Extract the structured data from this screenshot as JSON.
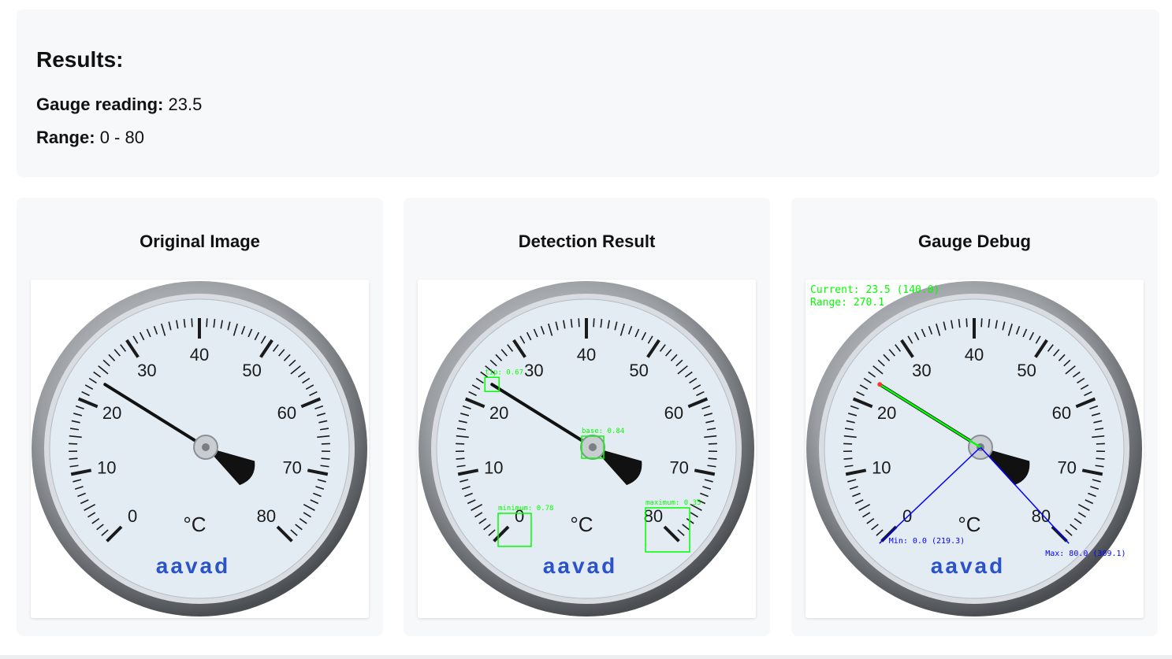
{
  "results": {
    "title": "Results:",
    "reading_label": "Gauge reading:",
    "reading_value": "23.5",
    "range_label": "Range:",
    "range_value": "0 - 80"
  },
  "cards": [
    {
      "title": "Original Image"
    },
    {
      "title": "Detection Result"
    },
    {
      "title": "Gauge Debug"
    }
  ],
  "gauge": {
    "scale_labels": [
      "0",
      "10",
      "20",
      "30",
      "40",
      "50",
      "60",
      "70",
      "80"
    ],
    "unit": "°C",
    "brand": "aavad",
    "min": 0,
    "max": 80,
    "needle_value": 23.5
  },
  "detections": {
    "tip": "tip: 0.67",
    "base": "base: 0.84",
    "minimum": "minimum: 0.78",
    "maximum": "maximum: 0.35"
  },
  "debug": {
    "current": "Current: 23.5 (140.0)",
    "range": "Range: 270.1",
    "min": "Min: 0.0 (219.3)",
    "max": "Max: 80.0 (309.1)"
  },
  "colors": {
    "detection": "#00ff00",
    "debug_line": "#0000ff",
    "brand": "#2a52c9"
  }
}
